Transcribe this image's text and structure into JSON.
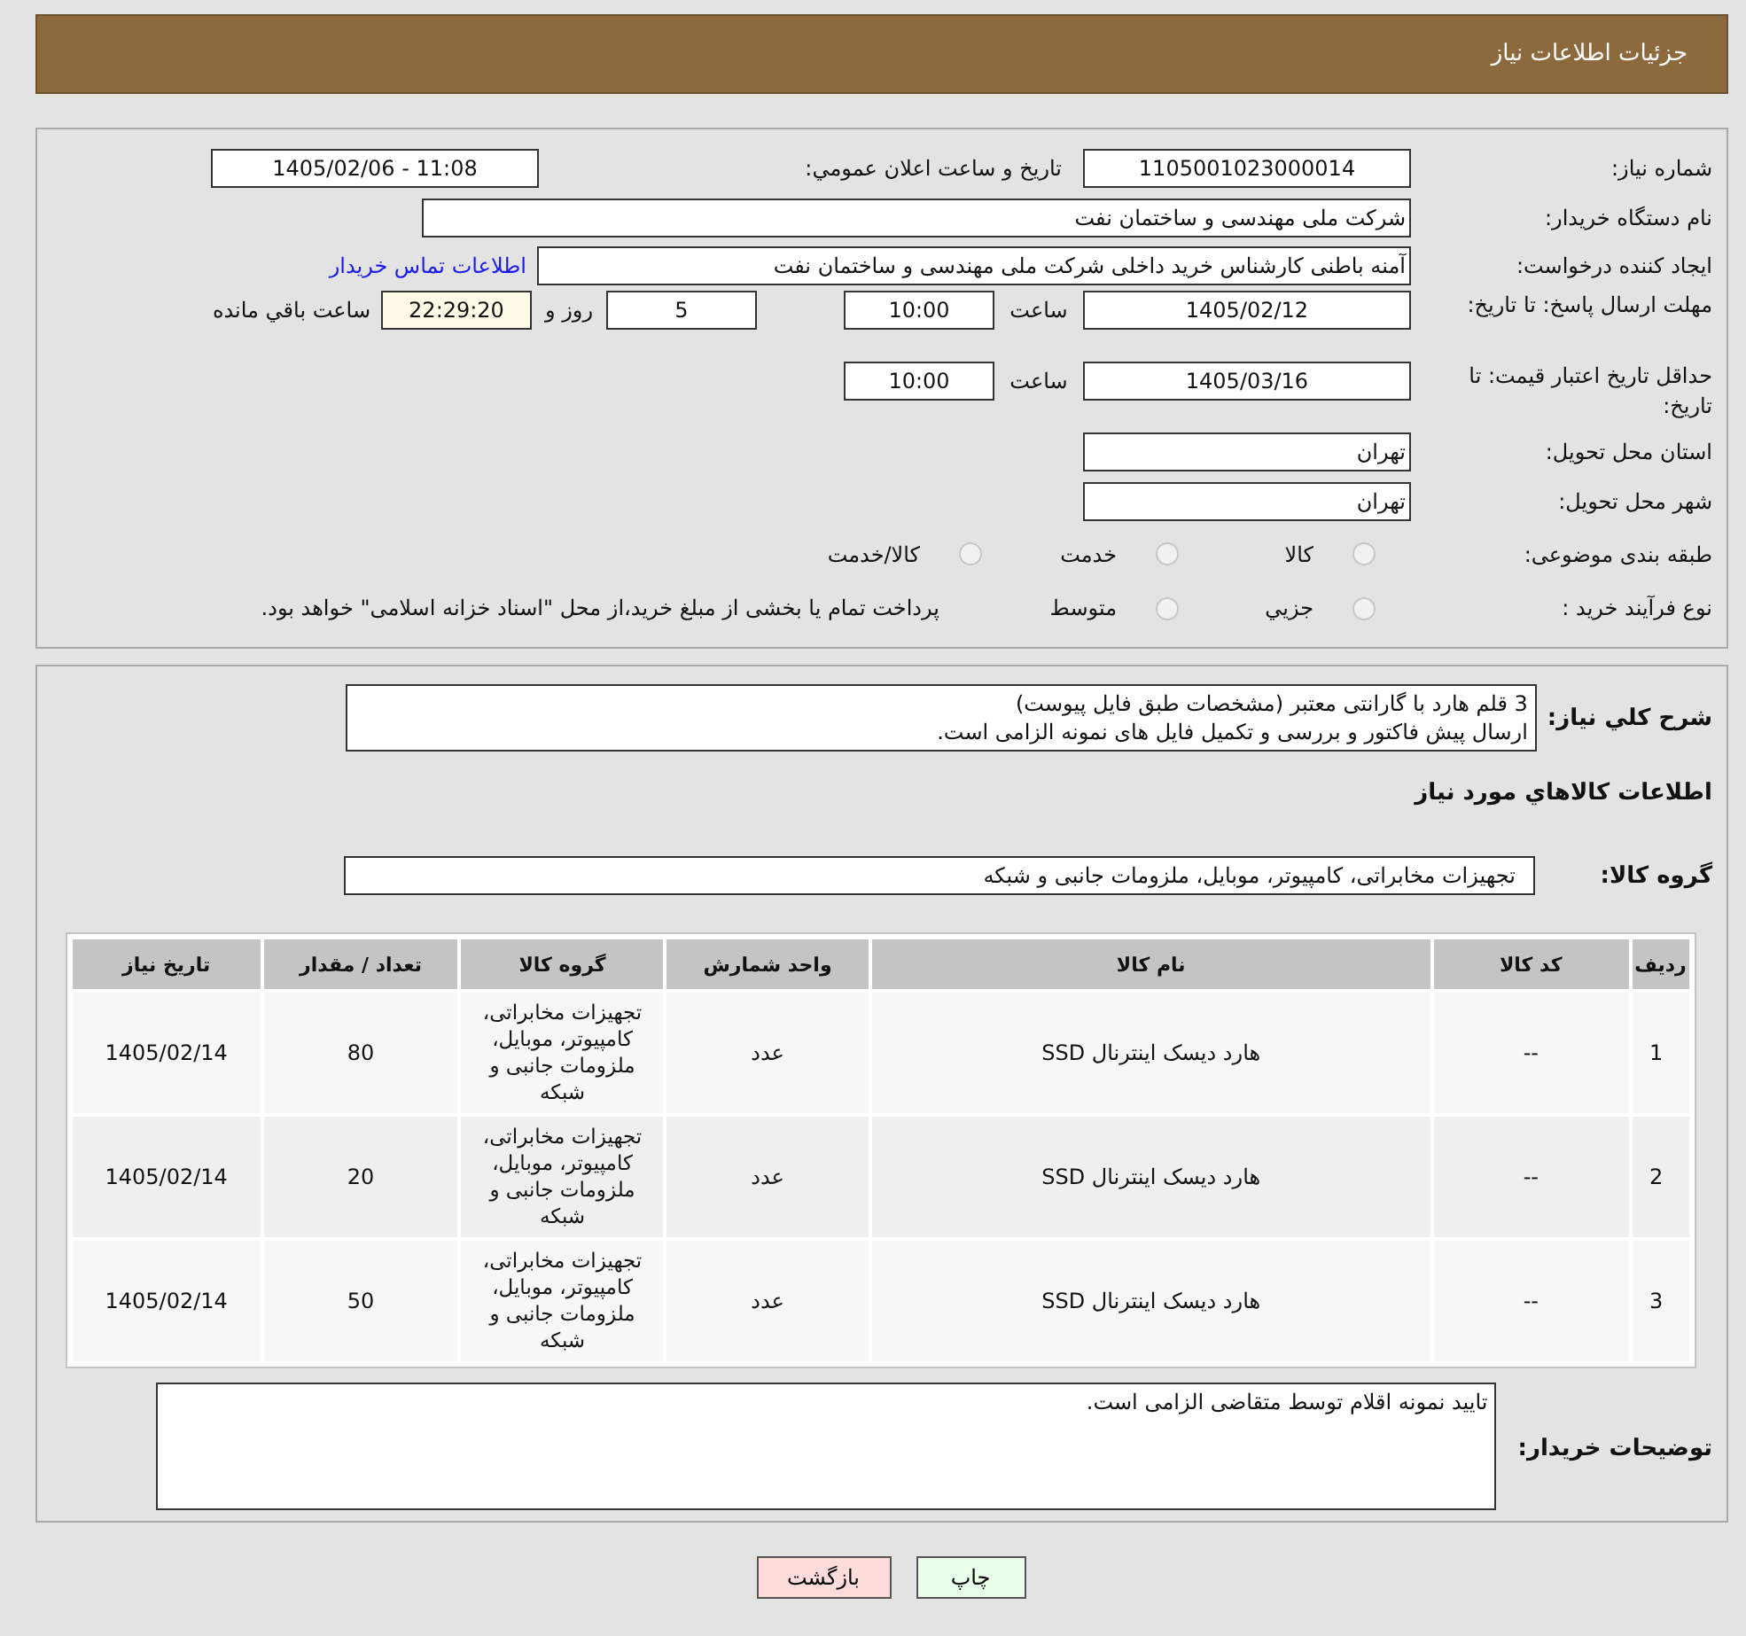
{
  "page_title": "جزئیات اطلاعات نیاز",
  "need_number": {
    "label": "شماره نیاز:",
    "value": "1105001023000014"
  },
  "announce": {
    "label": "تاریخ و ساعت اعلان عمومي:",
    "value": "1405/02/06 - 11:08"
  },
  "buyer_org": {
    "label": "نام دستگاه خریدار:",
    "value": "شرکت ملی مهندسی و ساختمان نفت"
  },
  "requester": {
    "label": "ایجاد کننده درخواست:",
    "value": "آمنه باطنی کارشناس خرید داخلی شرکت ملی مهندسی و ساختمان نفت",
    "link": "اطلاعات تماس خریدار"
  },
  "reply_deadline": {
    "label": "مهلت ارسال پاسخ: تا تاریخ:",
    "date": "1405/02/12",
    "time_label": "ساعت",
    "time": "10:00",
    "days": "5",
    "days_label": "روز و",
    "remaining": "22:29:20",
    "remaining_label": "ساعت باقي مانده"
  },
  "price_validity": {
    "label": "حداقل تاریخ اعتبار قیمت: تا تاریخ:",
    "date": "1405/03/16",
    "time_label": "ساعت",
    "time": "10:00"
  },
  "province": {
    "label": "استان محل تحویل:",
    "value": "تهران"
  },
  "city": {
    "label": "شهر محل تحویل:",
    "value": "تهران"
  },
  "category": {
    "label": "طبقه بندی موضوعی:",
    "options": [
      {
        "label": "کالا",
        "selected": false
      },
      {
        "label": "خدمت",
        "selected": false
      },
      {
        "label": "کالا/خدمت",
        "selected": false
      }
    ]
  },
  "purchase_type": {
    "label": "نوع فرآیند خرید :",
    "options": [
      {
        "label": "جزيي",
        "selected": false
      },
      {
        "label": "متوسط",
        "selected": false
      }
    ],
    "note": "پرداخت تمام یا بخشی از مبلغ خرید،از محل \"اسناد خزانه اسلامی\" خواهد بود."
  },
  "description": {
    "label": "شرح کلي نياز:",
    "value": "3 قلم هارد با گارانتی معتبر (مشخصات طبق فایل پیوست)\nارسال پیش فاکتور و بررسی و تکمیل فایل های نمونه الزامی است."
  },
  "goods_title": "اطلاعات کالاهاي مورد نياز",
  "goods_group": {
    "label": "گروه کالا:",
    "value": "تجهیزات مخابراتی، کامپیوتر، موبایل، ملزومات جانبی و شبکه"
  },
  "table": {
    "columns": [
      "ردیف",
      "کد کالا",
      "نام کالا",
      "واحد شمارش",
      "گروه کالا",
      "تعداد / مقدار",
      "تاریخ نیاز"
    ],
    "rows": [
      [
        "1",
        "--",
        "هارد دیسک اینترنال SSD",
        "عدد",
        "تجهیزات مخابراتی، کامپیوتر، موبایل، ملزومات جانبی و شبکه",
        "80",
        "1405/02/14"
      ],
      [
        "2",
        "--",
        "هارد دیسک اینترنال SSD",
        "عدد",
        "تجهیزات مخابراتی، کامپیوتر، موبایل، ملزومات جانبی و شبکه",
        "20",
        "1405/02/14"
      ],
      [
        "3",
        "--",
        "هارد دیسک اینترنال SSD",
        "عدد",
        "تجهیزات مخابراتی، کامپیوتر، موبایل، ملزومات جانبی و شبکه",
        "50",
        "1405/02/14"
      ]
    ]
  },
  "buyer_notes": {
    "label": "توضیحات خریدار:",
    "value": "تایید نمونه اقلام توسط متقاضی الزامی است."
  },
  "buttons": [
    {
      "label": "چاپ",
      "kind": "print"
    },
    {
      "label": "بازگشت",
      "kind": "back"
    }
  ]
}
